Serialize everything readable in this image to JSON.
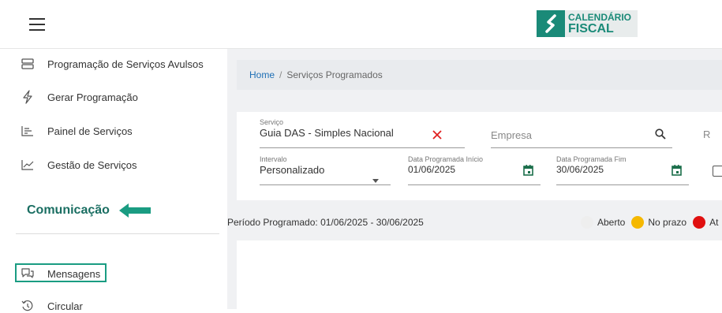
{
  "header": {
    "logo_top": "CALENDÁRIO",
    "logo_bottom": "FISCAL"
  },
  "sidebar": {
    "items": [
      {
        "label": "Programação de Serviços Avulsos",
        "icon": "list-stack-icon"
      },
      {
        "label": "Gerar Programação",
        "icon": "lightning-icon"
      },
      {
        "label": "Painel de Serviços",
        "icon": "panel-chart-icon"
      },
      {
        "label": "Gestão de Serviços",
        "icon": "trend-line-icon"
      }
    ],
    "section_title": "Comunicação",
    "comm_items": [
      {
        "label": "Mensagens",
        "icon": "chat-bubbles-icon"
      },
      {
        "label": "Circular",
        "icon": "history-icon"
      }
    ]
  },
  "breadcrumb": {
    "home": "Home",
    "separator": "/",
    "current": "Serviços Programados"
  },
  "filters": {
    "servico_label": "Serviço",
    "servico_value": "Guia DAS - Simples Nacional",
    "empresa_placeholder": "Empresa",
    "extra_partial": "R",
    "intervalo_label": "Intervalo",
    "intervalo_value": "Personalizado",
    "inicio_label": "Data Programada Início",
    "inicio_value": "01/06/2025",
    "fim_label": "Data Programada Fim",
    "fim_value": "30/06/2025"
  },
  "period": {
    "text": "Período Programado: 01/06/2025 - 30/06/2025"
  },
  "legend": [
    {
      "label": "Aberto",
      "color": "#eeeeee"
    },
    {
      "label": "No prazo",
      "color": "#f5b800"
    },
    {
      "label": "At",
      "color": "#e01010"
    }
  ],
  "colors": {
    "accent": "#1a8a78",
    "link": "#1e6fb5",
    "clear_x": "#e02020",
    "calendar": "#1a6e4a"
  }
}
